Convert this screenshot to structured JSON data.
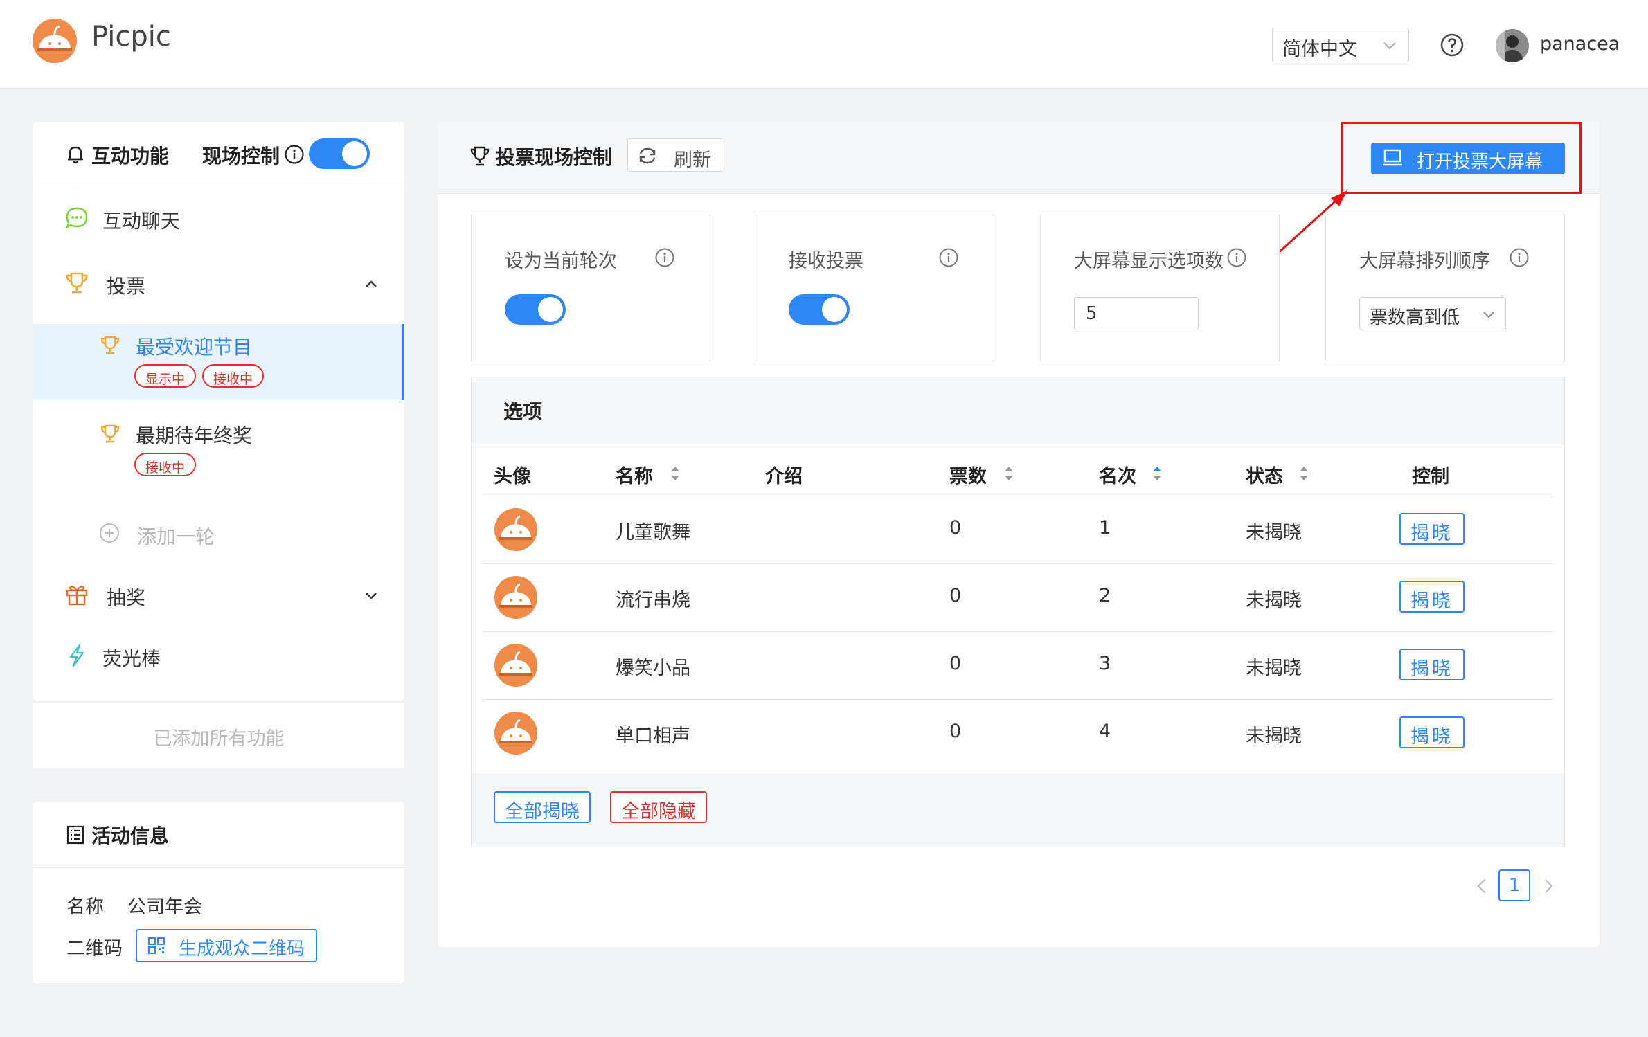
{
  "app": {
    "title": "Picpic"
  },
  "header": {
    "language": "简体中文",
    "user_name": "panacea"
  },
  "left_panel": {
    "title": "互动功能",
    "live_control_label": "现场控制",
    "live_control_on": true,
    "nav": {
      "chat": "互动聊天",
      "vote": "投票",
      "lottery": "抽奖",
      "glowstick": "荧光棒"
    },
    "vote_rounds": [
      {
        "name": "最受欢迎节目",
        "tags": [
          "显示中",
          "接收中"
        ],
        "active": true
      },
      {
        "name": "最期待年终奖",
        "tags": [
          "接收中"
        ],
        "active": false
      }
    ],
    "add_round": "添加一轮",
    "footer": "已添加所有功能"
  },
  "activity_info": {
    "title": "活动信息",
    "name_label": "名称",
    "name_value": "公司年会",
    "qr_label": "二维码",
    "qr_button": "生成观众二维码"
  },
  "main": {
    "title": "投票现场控制",
    "refresh": "刷新",
    "open_big_screen": "打开投票大屏幕",
    "cards": {
      "set_current_round": {
        "label": "设为当前轮次",
        "on": true
      },
      "receive_votes": {
        "label": "接收投票",
        "on": true
      },
      "display_count": {
        "label": "大屏幕显示选项数",
        "value": "5"
      },
      "sort_order": {
        "label": "大屏幕排列顺序",
        "value": "票数高到低"
      }
    },
    "options": {
      "title": "选项",
      "columns": [
        "头像",
        "名称",
        "介绍",
        "票数",
        "名次",
        "状态",
        "控制"
      ],
      "rows": [
        {
          "name": "儿童歌舞",
          "intro": "",
          "votes": "0",
          "rank": "1",
          "status": "未揭晓",
          "action": "揭晓"
        },
        {
          "name": "流行串烧",
          "intro": "",
          "votes": "0",
          "rank": "2",
          "status": "未揭晓",
          "action": "揭晓"
        },
        {
          "name": "爆笑小品",
          "intro": "",
          "votes": "0",
          "rank": "3",
          "status": "未揭晓",
          "action": "揭晓"
        },
        {
          "name": "单口相声",
          "intro": "",
          "votes": "0",
          "rank": "4",
          "status": "未揭晓",
          "action": "揭晓"
        }
      ],
      "reveal_all": "全部揭晓",
      "hide_all": "全部隐藏"
    },
    "pagination": {
      "current_page": "1"
    }
  },
  "colors": {
    "primary": "#2f87f5",
    "danger": "#e0332c",
    "logo_orange": "#ef8a4b",
    "annotation_red": "#e31414"
  },
  "icons": [
    "logo-icon",
    "chevron-down-icon",
    "help-icon",
    "bell-icon",
    "info-icon",
    "chat-icon",
    "trophy-icon",
    "chevron-up-icon",
    "plus-circle-icon",
    "gift-icon",
    "lightning-icon",
    "list-icon",
    "qrcode-icon",
    "refresh-icon",
    "monitor-icon",
    "sort-icon",
    "chevron-left-icon",
    "chevron-right-icon"
  ]
}
